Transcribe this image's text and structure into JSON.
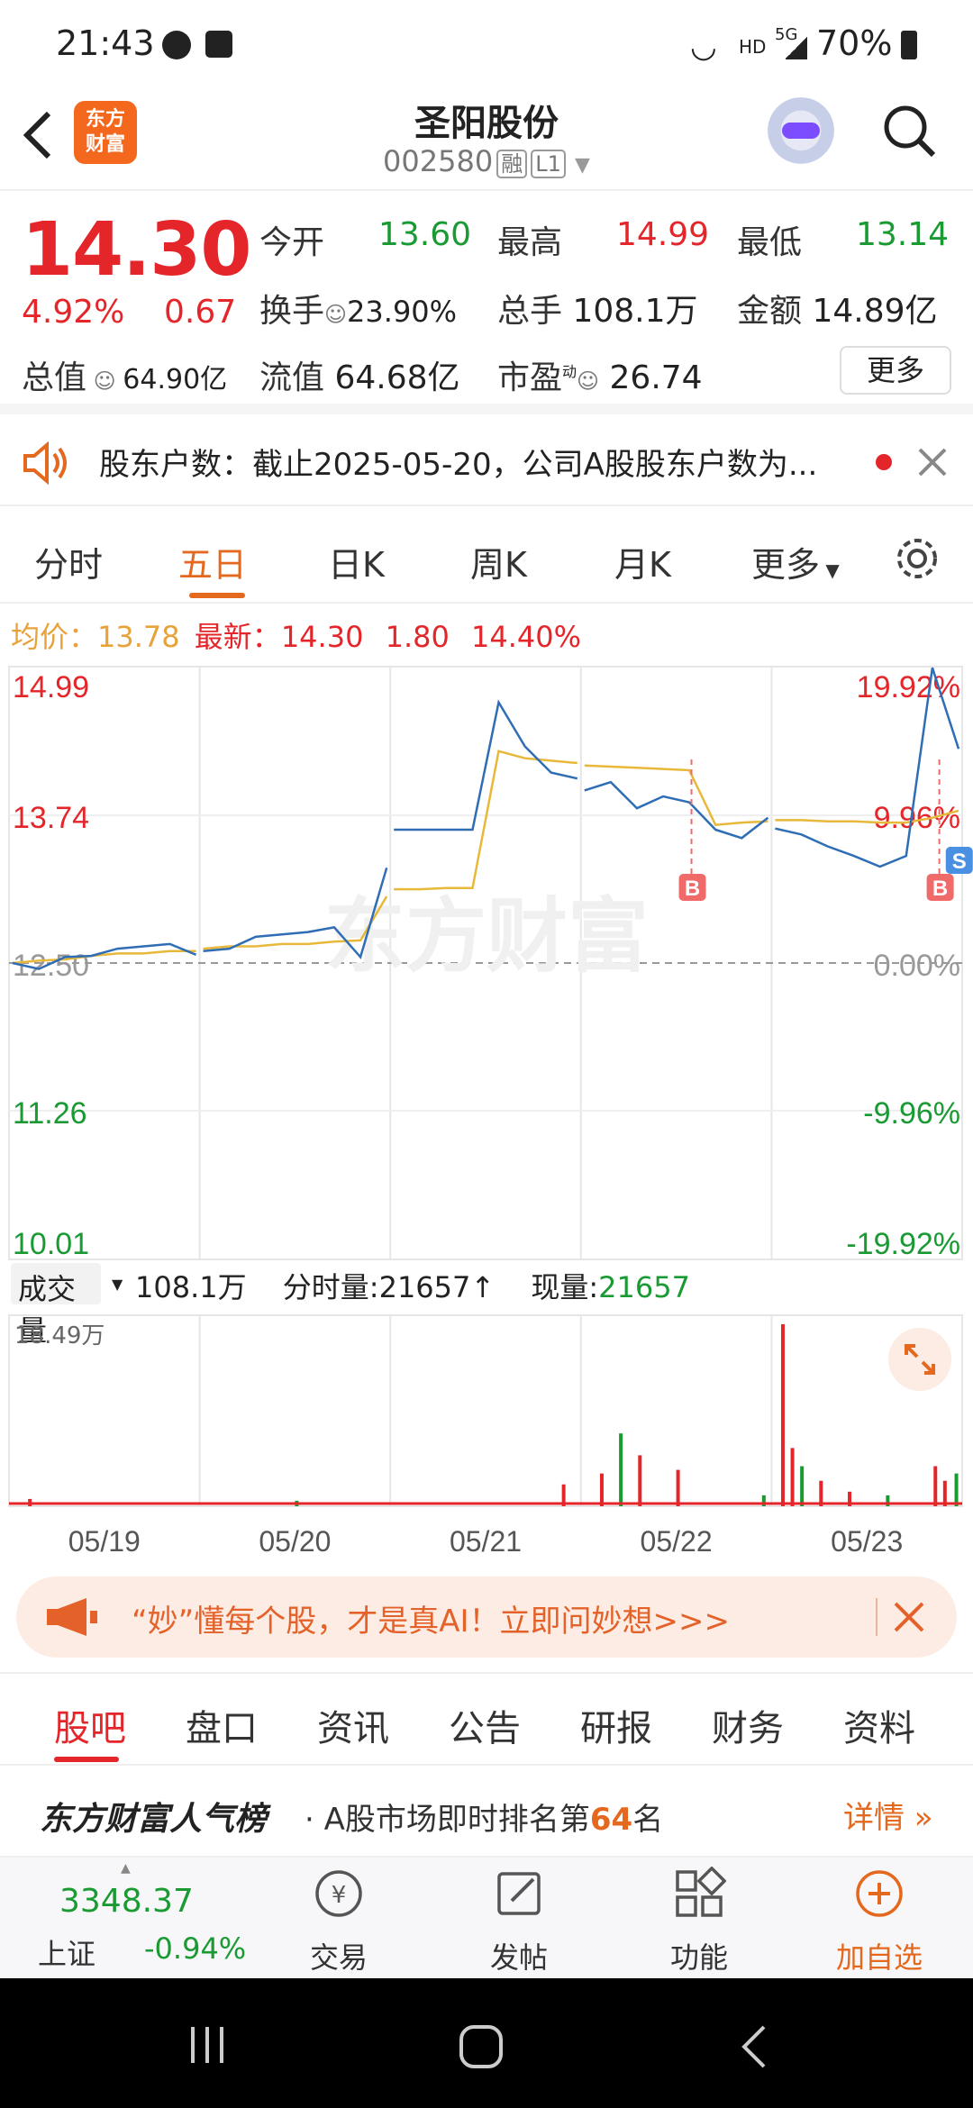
{
  "status_bar": {
    "time": "21:43",
    "battery": "70%",
    "network": "5G",
    "hd": "HD"
  },
  "header": {
    "logo_text_1": "东方",
    "logo_text_2": "财富",
    "stock_name": "圣阳股份",
    "stock_code": "002580",
    "tag_margin": "融",
    "tag_level": "L1"
  },
  "quote": {
    "price": "14.30",
    "change_pct": "4.92%",
    "change": "0.67",
    "open_label": "今开",
    "open": "13.60",
    "high_label": "最高",
    "high": "14.99",
    "low_label": "最低",
    "low": "13.14",
    "turnover_label": "换手",
    "turnover": "23.90%",
    "volume_label": "总手",
    "volume": "108.1万",
    "amount_label": "金额",
    "amount": "14.89亿",
    "mktcap_label": "总值",
    "mktcap": "64.90亿",
    "float_label": "流值",
    "float_cap": "64.68亿",
    "pe_label": "市盈",
    "pe_sup": "动",
    "pe": "26.74",
    "more_label": "更多"
  },
  "notice": {
    "text": "股东户数：截止2025-05-20，公司A股股东户数为..."
  },
  "tabs": {
    "items": [
      "分时",
      "五日",
      "日K",
      "周K",
      "月K",
      "更多"
    ],
    "active": "五日"
  },
  "legend": {
    "avg_label": "均价：",
    "avg": "13.78",
    "latest_label": "最新：",
    "latest": "14.30",
    "chg": "1.80",
    "pct": "14.40%"
  },
  "chart_data": {
    "type": "line",
    "x": [
      "05/19",
      "05/20",
      "05/21",
      "05/22",
      "05/23"
    ],
    "ylim": [
      10.01,
      14.99
    ],
    "y_ticks_left": [
      "14.99",
      "13.74",
      "12.50",
      "11.26",
      "10.01"
    ],
    "y_ticks_right": [
      "19.92%",
      "9.96%",
      "0.00%",
      "-9.96%",
      "-19.92%"
    ],
    "reference_price": 12.5,
    "watermark": "东方财富",
    "series": [
      {
        "name": "最新",
        "color": "#2f6db5",
        "values": [
          12.5,
          12.45,
          12.55,
          12.56,
          12.62,
          12.64,
          12.66,
          12.57,
          12.6,
          12.62,
          12.72,
          12.74,
          12.76,
          12.8,
          12.55,
          13.3,
          13.62,
          13.62,
          13.62,
          13.62,
          14.69,
          14.32,
          14.1,
          14.05,
          13.95,
          14.02,
          13.8,
          13.9,
          13.85,
          13.62,
          13.55,
          13.72,
          13.63,
          13.58,
          13.48,
          13.4,
          13.31,
          13.4,
          14.98,
          14.3
        ]
      },
      {
        "name": "均价",
        "color": "#e8b83a",
        "values": [
          12.5,
          12.52,
          12.53,
          12.56,
          12.58,
          12.58,
          12.6,
          12.6,
          12.62,
          12.64,
          12.64,
          12.66,
          12.66,
          12.68,
          12.69,
          13.06,
          13.12,
          13.12,
          13.13,
          13.13,
          14.28,
          14.22,
          14.2,
          14.18,
          14.16,
          14.15,
          14.14,
          14.13,
          14.12,
          13.66,
          13.68,
          13.69,
          13.7,
          13.7,
          13.69,
          13.69,
          13.68,
          13.68,
          13.72,
          13.78
        ]
      }
    ],
    "markers": [
      {
        "label": "B",
        "x_day": 3.58
      },
      {
        "label": "B",
        "x_day": 4.88
      },
      {
        "label": "S",
        "x_day": 4.98
      }
    ]
  },
  "volume_panel": {
    "label": "成交量",
    "total": "108.1万",
    "tick_label": "分时量:21657",
    "current_label": "现量:",
    "current": "21657",
    "max": "18.49万"
  },
  "ad": {
    "text": "“妙”懂每个股，才是真AI！立即问妙想>>>"
  },
  "tabs2": {
    "items": [
      "股吧",
      "盘口",
      "资讯",
      "公告",
      "研报",
      "财务",
      "资料"
    ],
    "active": "股吧"
  },
  "rank": {
    "brand": "东方财富人气榜",
    "text_1": "· A股市场即时排名第",
    "rank": "64",
    "text_2": "名",
    "detail": "详情"
  },
  "bottom": {
    "index_value": "3348.37",
    "index_name": "上证",
    "index_pct": "-0.94%",
    "items": [
      "交易",
      "发帖",
      "功能",
      "加自选"
    ]
  }
}
